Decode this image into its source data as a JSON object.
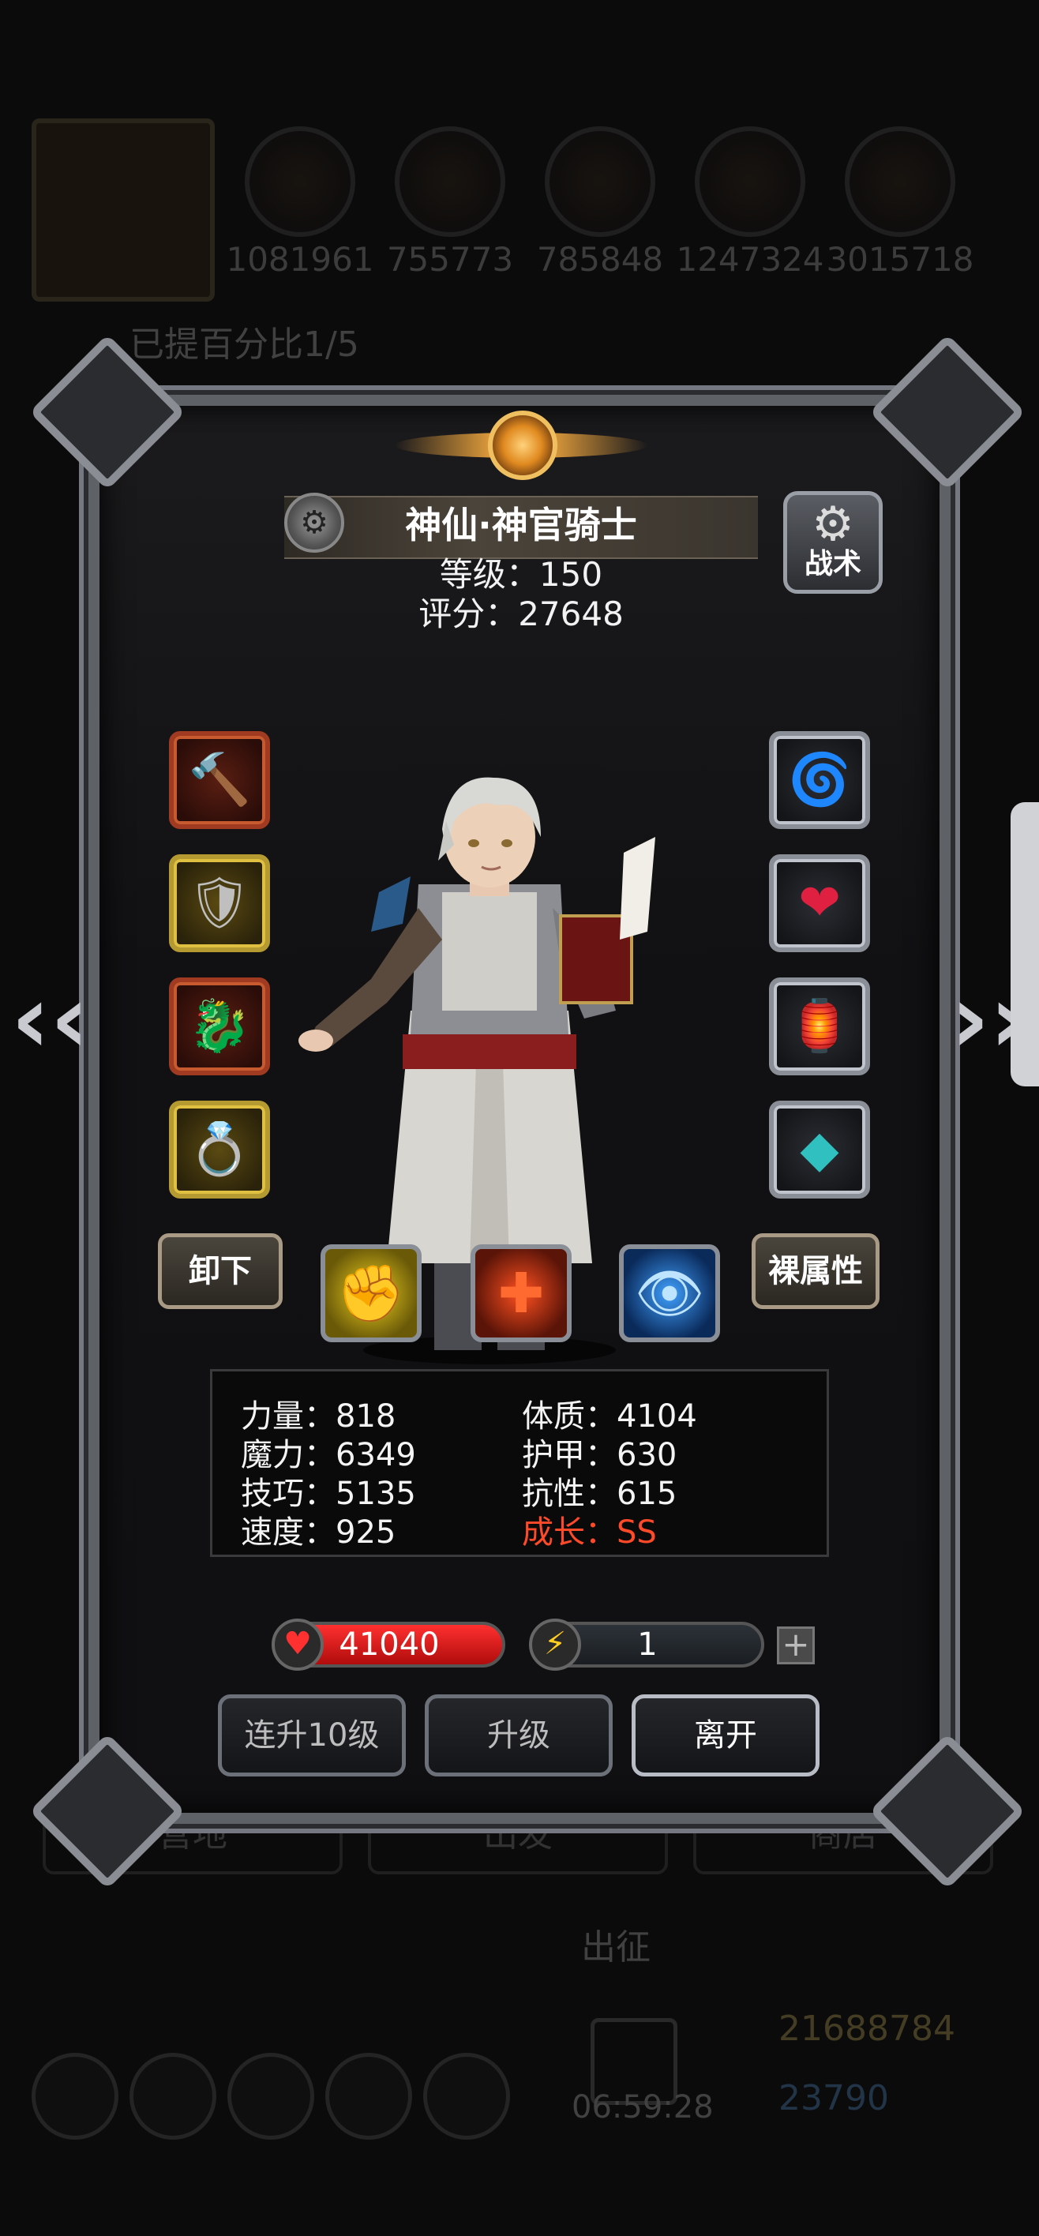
{
  "background": {
    "resources": [
      "1081961",
      "755773",
      "785848",
      "1247324",
      "3015718"
    ],
    "quest_text": "已提百分比1/5",
    "tabs": [
      "营地",
      "出发",
      "商店"
    ],
    "sortie_label": "出征",
    "timer": "06:59:28",
    "gold": "21688784",
    "gems": "23790"
  },
  "character": {
    "title": "神仙·神官骑士",
    "level_line": "等级：150",
    "score_line": "评分：27648"
  },
  "tactics_button": {
    "label": "战术"
  },
  "equipment_left": [
    {
      "icon": "war-hammer",
      "rarity": "red"
    },
    {
      "icon": "chest-armor",
      "rarity": "gold"
    },
    {
      "icon": "dragon-helm",
      "rarity": "red"
    },
    {
      "icon": "emerald-ring",
      "rarity": "gold"
    }
  ],
  "equipment_right": [
    {
      "icon": "storm-amulet",
      "rarity": "silver"
    },
    {
      "icon": "ruby-charm",
      "rarity": "silver"
    },
    {
      "icon": "lantern",
      "rarity": "silver"
    },
    {
      "icon": "turquoise-stone",
      "rarity": "silver"
    }
  ],
  "buttons": {
    "unequip": "卸下",
    "naked_attributes": "裸属性",
    "level_up_10": "连升10级",
    "level_up": "升级",
    "leave": "离开"
  },
  "skills": [
    {
      "icon": "fist-icon",
      "color": "#f0d020"
    },
    {
      "icon": "heal-cross-icon",
      "color": "#e03a10"
    },
    {
      "icon": "eye-icon",
      "color": "#2a8ae0"
    }
  ],
  "stats": {
    "strength": "力量：818",
    "magic": "魔力：6349",
    "skill": "技巧：5135",
    "speed": "速度：925",
    "constitution": "体质：4104",
    "armor": "护甲：630",
    "resistance": "抗性：615",
    "growth": "成长：SS"
  },
  "hp": "41040",
  "energy": "1",
  "colors": {
    "accent_gold": "#f0c060",
    "hp_red": "#e02020",
    "growth_red": "#ff4a2a"
  }
}
